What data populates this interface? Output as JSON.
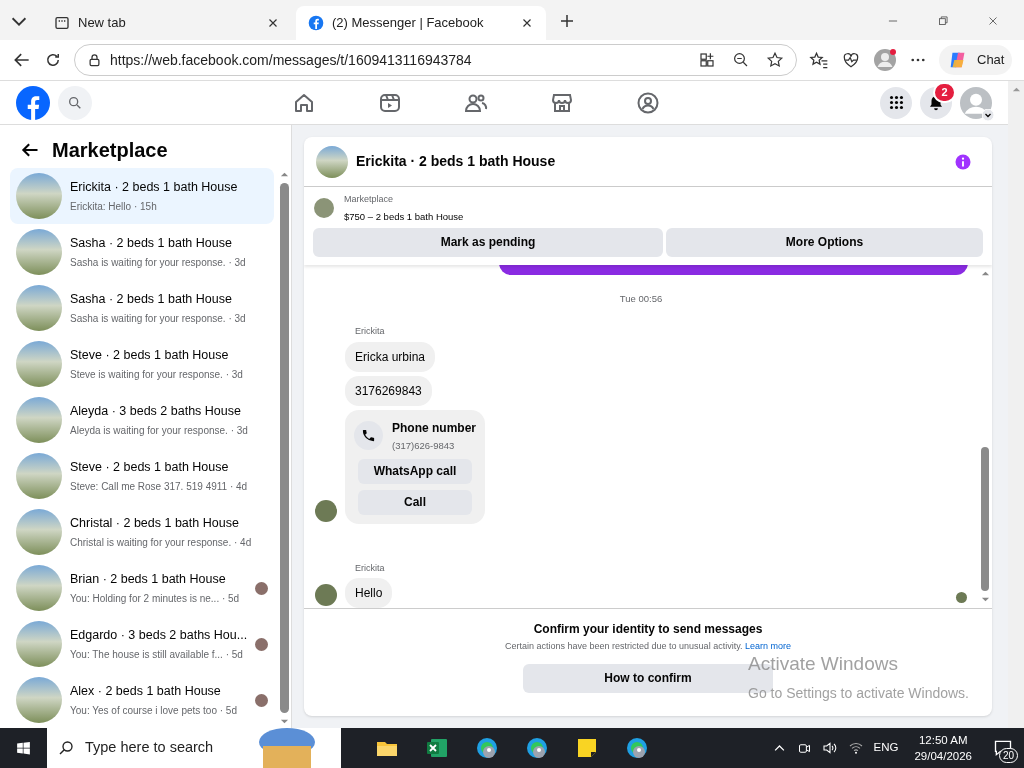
{
  "browser": {
    "tabs": [
      {
        "title": "New tab",
        "selected": false,
        "kind": "newtab"
      },
      {
        "title": "(2) Messenger | Facebook",
        "selected": true,
        "kind": "facebook"
      }
    ],
    "url": "https://web.facebook.com/messages/t/1609413116943784",
    "chat_label": "Chat"
  },
  "header": {
    "notification_count": "2",
    "nav": [
      {
        "kind": "home"
      },
      {
        "kind": "video"
      },
      {
        "kind": "friends"
      },
      {
        "kind": "marketplace"
      },
      {
        "kind": "groups"
      }
    ]
  },
  "sidebar": {
    "title": "Marketplace",
    "conversations": [
      {
        "title": "Erickita · 2 beds 1 bath House",
        "preview": "Erickita: Hello · 15h",
        "selected": true,
        "seen": false
      },
      {
        "title": "Sasha · 2 beds 1 bath House",
        "preview": "Sasha is waiting for your response. · 3d",
        "selected": false,
        "seen": false
      },
      {
        "title": "Sasha · 2 beds 1 bath House",
        "preview": "Sasha is waiting for your response. · 3d",
        "selected": false,
        "seen": false
      },
      {
        "title": "Steve · 2 beds 1 bath House",
        "preview": "Steve is waiting for your response. · 3d",
        "selected": false,
        "seen": false
      },
      {
        "title": "Aleyda · 3 beds 2 baths House",
        "preview": "Aleyda is waiting for your response. · 3d",
        "selected": false,
        "seen": false
      },
      {
        "title": "Steve · 2 beds 1 bath House",
        "preview": "Steve: Call me Rose 317. 519 4911 · 4d",
        "selected": false,
        "seen": false
      },
      {
        "title": "Christal · 2 beds 1 bath House",
        "preview": "Christal is waiting for your response. · 4d",
        "selected": false,
        "seen": false
      },
      {
        "title": "Brian · 2 beds 1 bath House",
        "preview": "You: Holding for 2 minutes is ne... · 5d",
        "selected": false,
        "seen": true
      },
      {
        "title": "Edgardo · 3 beds 2 baths Hou...",
        "preview": "You: The house is still available f... · 5d",
        "selected": false,
        "seen": true
      },
      {
        "title": "Alex · 2 beds 1 bath House",
        "preview": "You: Yes of course i love pets too · 5d",
        "selected": false,
        "seen": true
      }
    ]
  },
  "chat": {
    "title": "Erickita · 2 beds 1 bath House",
    "listing": {
      "label": "Marketplace",
      "description": "$750 – 2 beds 1 bath House"
    },
    "actions": [
      "Mark as pending",
      "More Options"
    ],
    "timestamp": "Tue 00:56",
    "groups": [
      {
        "sender": "Erickita",
        "messages": [
          {
            "kind": "text",
            "text": "Ericka urbina"
          },
          {
            "kind": "text",
            "text": "3176269843"
          },
          {
            "kind": "phone",
            "title": "Phone number",
            "number": "(317)626-9843",
            "buttons": [
              "WhatsApp call",
              "Call"
            ]
          }
        ]
      },
      {
        "sender": "Erickita",
        "messages": [
          {
            "kind": "text",
            "text": "Hello"
          }
        ]
      }
    ],
    "notice": {
      "title": "Confirm your identity to send messages",
      "text": "Certain actions have been restricted due to unusual activity.",
      "link": "Learn more",
      "button": "How to confirm"
    }
  },
  "os_overlay": {
    "title": "Activate Windows",
    "text": "Go to Settings to activate Windows."
  },
  "taskbar": {
    "search_placeholder": "Type here to search",
    "apps": [
      {
        "kind": "folder"
      },
      {
        "kind": "excel"
      },
      {
        "kind": "edge"
      },
      {
        "kind": "edge"
      },
      {
        "kind": "notes"
      },
      {
        "kind": "edge"
      }
    ],
    "language": "ENG",
    "time": "12:50 AM",
    "date": "29/04/2026",
    "notifications": "20"
  }
}
